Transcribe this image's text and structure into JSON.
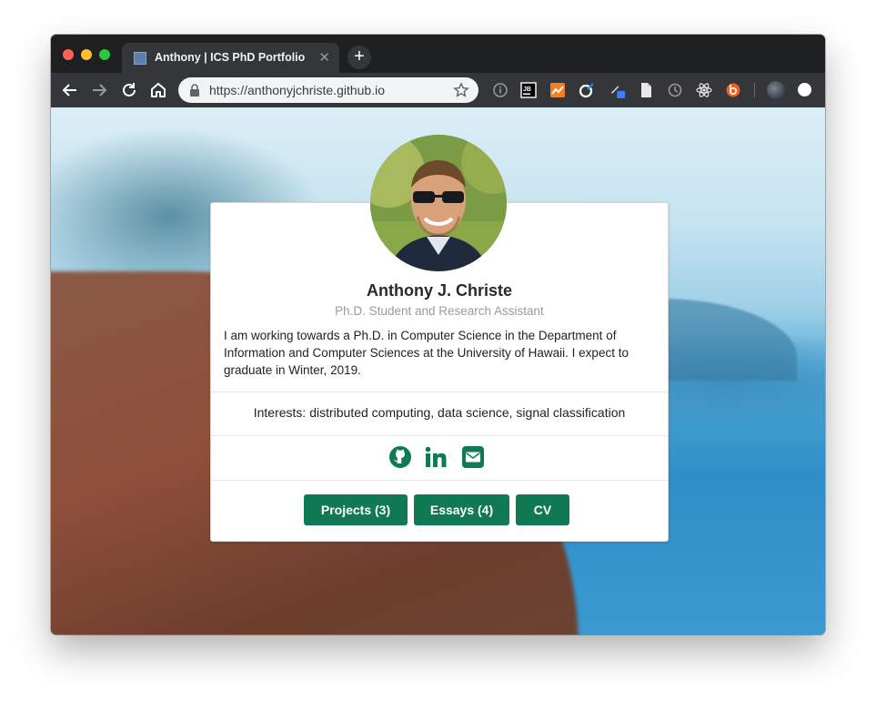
{
  "browser": {
    "tab": {
      "title": "Anthony | ICS PhD Portfolio",
      "close": "✕"
    },
    "new_tab": "+",
    "url": "https://anthonyjchriste.github.io",
    "icons": [
      "back-icon",
      "forward-icon",
      "reload-icon",
      "home-icon",
      "lock-icon",
      "bookmark-star-icon"
    ],
    "extensions": [
      "info-icon",
      "jb-icon",
      "analytics-icon",
      "extension-c-icon",
      "pen-icon",
      "document-icon",
      "timer-icon",
      "react-icon",
      "bitly-icon"
    ],
    "ext_labels": {
      "jb": "JB"
    }
  },
  "profile": {
    "name": "Anthony J. Christe",
    "role": "Ph.D. Student and Research Assistant",
    "bio": "I am working towards a Ph.D. in Computer Science in the Department of Information and Computer Sciences at the University of Hawaii. I expect to graduate in Winter, 2019.",
    "interests": "Interests: distributed computing, data science, signal classification"
  },
  "social_icons": [
    "github-icon",
    "linkedin-icon",
    "email-icon"
  ],
  "buttons": [
    {
      "label": "Projects (3)"
    },
    {
      "label": "Essays (4)"
    },
    {
      "label": "CV"
    }
  ],
  "colors": {
    "accent": "#127a52",
    "titlebar": "#1e1f21",
    "toolbar": "#35363a"
  }
}
